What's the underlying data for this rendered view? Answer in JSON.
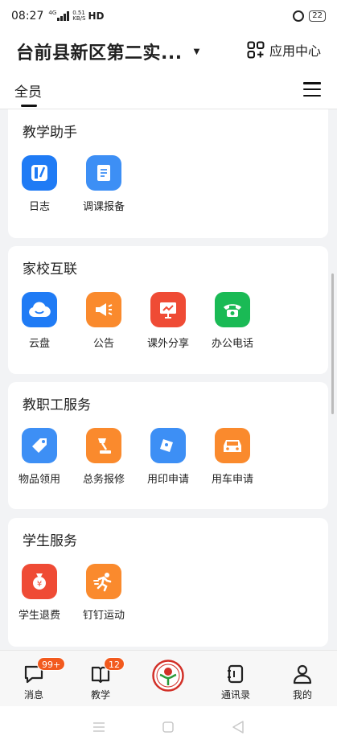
{
  "status_bar": {
    "time": "08:27",
    "network": "4G",
    "speed_value": "0.51",
    "speed_unit": "KB/S",
    "hd": "HD",
    "battery": "22"
  },
  "header": {
    "school_name": "台前县新区第二实...",
    "app_center_label": "应用中心",
    "tab_all": "全员"
  },
  "sections": [
    {
      "title": "教学助手",
      "apps": [
        {
          "label": "日志",
          "icon": "notebook-icon",
          "color": "#1f7bf5"
        },
        {
          "label": "调课报备",
          "icon": "document-icon",
          "color": "#3d8ff5"
        }
      ]
    },
    {
      "title": "家校互联",
      "apps": [
        {
          "label": "云盘",
          "icon": "cloud-icon",
          "color": "#1f7bf5"
        },
        {
          "label": "公告",
          "icon": "megaphone-icon",
          "color": "#fa8a2d"
        },
        {
          "label": "课外分享",
          "icon": "presentation-icon",
          "color": "#ef4b35"
        },
        {
          "label": "办公电话",
          "icon": "telephone-icon",
          "color": "#1aba55"
        }
      ]
    },
    {
      "title": "教职工服务",
      "apps": [
        {
          "label": "物品领用",
          "icon": "tag-icon",
          "color": "#3d8ff5"
        },
        {
          "label": "总务报修",
          "icon": "lamp-icon",
          "color": "#fa8a2d"
        },
        {
          "label": "用印申请",
          "icon": "seal-icon",
          "color": "#3d8ff5"
        },
        {
          "label": "用车申请",
          "icon": "car-icon",
          "color": "#fa8a2d"
        }
      ]
    },
    {
      "title": "学生服务",
      "apps": [
        {
          "label": "学生退费",
          "icon": "money-bag-icon",
          "color": "#ef4b35"
        },
        {
          "label": "钉钉运动",
          "icon": "runner-icon",
          "color": "#fa8a2d"
        }
      ]
    }
  ],
  "bottom_nav": {
    "messages": {
      "label": "消息",
      "badge": "99+"
    },
    "teaching": {
      "label": "教学",
      "badge": "12"
    },
    "contacts": {
      "label": "通讯录"
    },
    "mine": {
      "label": "我的"
    }
  },
  "colors": {
    "badge": "#f25a1e",
    "accent_blue": "#1f7bf5",
    "accent_orange": "#fa8a2d"
  }
}
